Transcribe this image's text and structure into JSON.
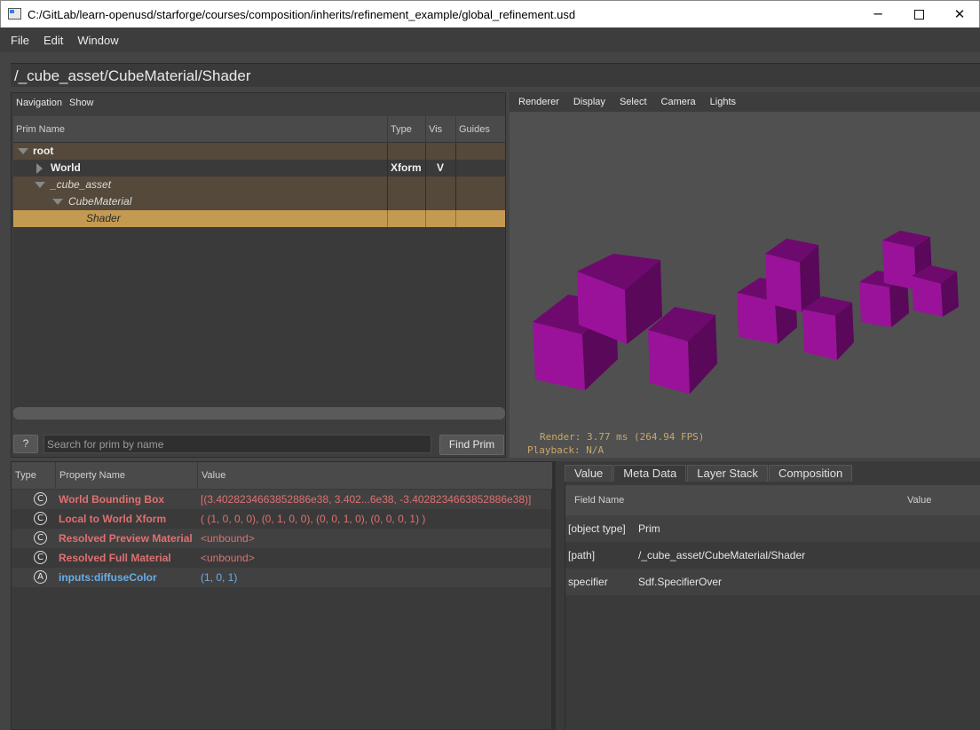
{
  "window": {
    "title": "C:/GitLab/learn-openusd/starforge/courses/composition/inherits/refinement_example/global_refinement.usd",
    "minimize": "─",
    "close": "✕"
  },
  "menubar": {
    "items": [
      "File",
      "Edit",
      "Window"
    ]
  },
  "path": "/_cube_asset/CubeMaterial/Shader",
  "tree": {
    "menu": [
      "Navigation",
      "Show"
    ],
    "columns": [
      "Prim Name",
      "Type",
      "Vis",
      "Guides"
    ],
    "rows": [
      {
        "name": "root",
        "type": "",
        "vis": ""
      },
      {
        "name": "World",
        "type": "Xform",
        "vis": "V"
      },
      {
        "name": "_cube_asset",
        "type": "",
        "vis": ""
      },
      {
        "name": "CubeMaterial",
        "type": "",
        "vis": ""
      },
      {
        "name": "Shader",
        "type": "",
        "vis": ""
      }
    ],
    "help_label": "?",
    "search_placeholder": "Search for prim by name",
    "find_label": "Find Prim"
  },
  "viewport": {
    "menu": [
      "Renderer",
      "Display",
      "Select",
      "Camera",
      "Lights"
    ],
    "render_stat": "Render: 3.77 ms (264.94 FPS)",
    "playback_stat": "Playback: N/A",
    "cube_color": "#8e0e8e"
  },
  "properties": {
    "columns": [
      "Type",
      "Property Name",
      "Value"
    ],
    "rows": [
      {
        "badge": "C",
        "name": "World Bounding Box",
        "value": "[(3.4028234663852886e38, 3.402...6e38, -3.4028234663852886e38)]",
        "color": "#e07070"
      },
      {
        "badge": "C",
        "name": "Local to World Xform",
        "value": "( (1, 0, 0, 0), (0, 1, 0, 0), (0, 0, 1, 0), (0, 0, 0, 1) )",
        "color": "#e07070"
      },
      {
        "badge": "C",
        "name": "Resolved Preview Material",
        "value": "<unbound>",
        "color": "#e07070"
      },
      {
        "badge": "C",
        "name": "Resolved Full Material",
        "value": "<unbound>",
        "color": "#e07070"
      },
      {
        "badge": "A",
        "name": "inputs:diffuseColor",
        "value": "(1, 0, 1)",
        "color": "#6aaee8"
      }
    ]
  },
  "metadata": {
    "tabs": [
      "Value",
      "Meta Data",
      "Layer Stack",
      "Composition"
    ],
    "active_tab": "Meta Data",
    "columns": [
      "Field Name",
      "Value"
    ],
    "rows": [
      {
        "field": "[object type]",
        "value": "Prim"
      },
      {
        "field": "[path]",
        "value": "/_cube_asset/CubeMaterial/Shader"
      },
      {
        "field": "specifier",
        "value": "Sdf.SpecifierOver"
      }
    ]
  }
}
